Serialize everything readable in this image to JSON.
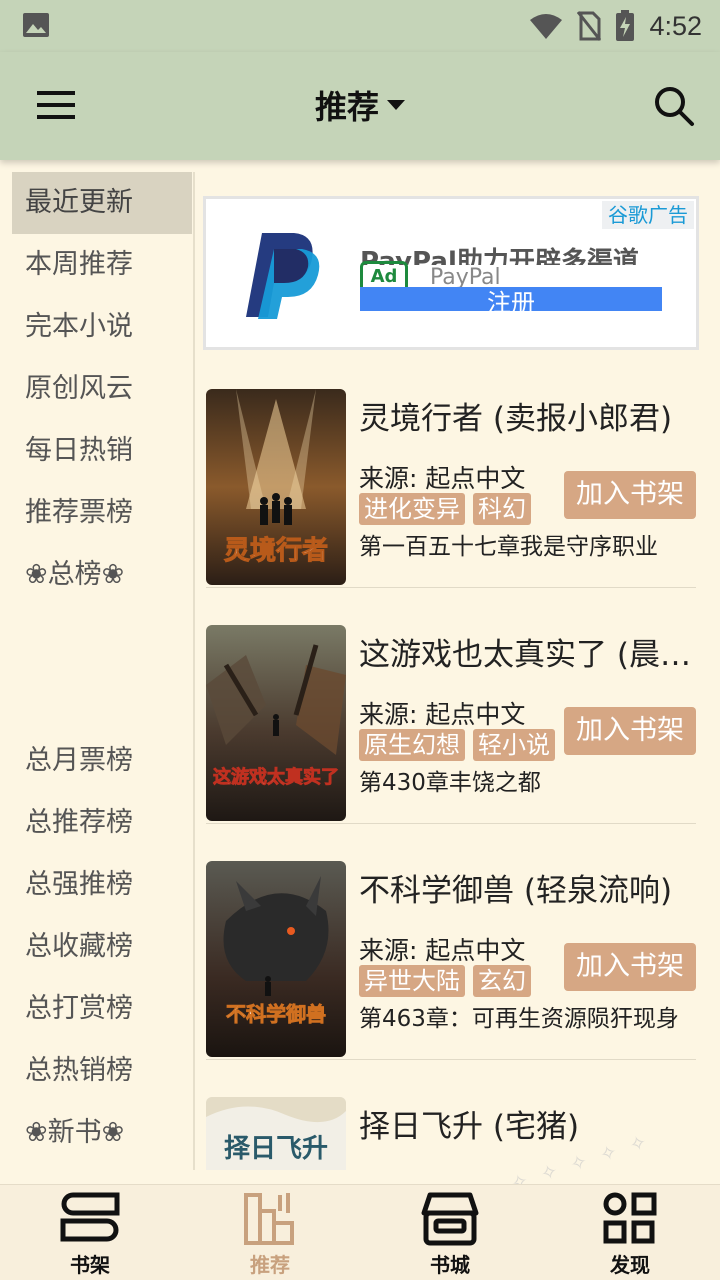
{
  "status_bar": {
    "time": "4:52"
  },
  "toolbar": {
    "title": "推荐"
  },
  "categories": [
    {
      "label": "最近更新",
      "active": true
    },
    {
      "label": "本周推荐"
    },
    {
      "label": "完本小说"
    },
    {
      "label": "原创风云"
    },
    {
      "label": "每日热销"
    },
    {
      "label": "推荐票榜"
    },
    {
      "label": "❀总榜❀"
    },
    {
      "label": ""
    },
    {
      "label": "总月票榜"
    },
    {
      "label": "总推荐榜"
    },
    {
      "label": "总强推榜"
    },
    {
      "label": "总收藏榜"
    },
    {
      "label": "总打赏榜"
    },
    {
      "label": "总热销榜"
    },
    {
      "label": "❀新书❀"
    }
  ],
  "ad": {
    "tag": "谷歌广告",
    "headline": "PayPal助力开辟多渠道",
    "badge": "Ad",
    "brand": "PayPal",
    "cta": "注册"
  },
  "books": [
    {
      "title": "灵境行者 (卖报小郎君)",
      "source": "来源: 起点中文",
      "tags": [
        "进化变异",
        "科幻"
      ],
      "latest": "第一百五十七章我是守序职业",
      "add_label": "加入书架",
      "cover_text": "灵境行者"
    },
    {
      "title": "这游戏也太真实了 (晨星LL)",
      "source": "来源: 起点中文",
      "tags": [
        "原生幻想",
        "轻小说"
      ],
      "latest": "第430章丰饶之都",
      "add_label": "加入书架",
      "cover_text": "这游戏太真实了"
    },
    {
      "title": "不科学御兽 (轻泉流响)",
      "source": "来源: 起点中文",
      "tags": [
        "异世大陆",
        "玄幻"
      ],
      "latest": "第463章：可再生资源陨犴现身",
      "add_label": "加入书架",
      "cover_text": "不科学御兽"
    },
    {
      "title": "择日飞升 (宅猪)",
      "source": "",
      "tags": [],
      "latest": "",
      "add_label": "",
      "cover_text": "择日飞升"
    }
  ],
  "bottom_nav": [
    {
      "label": "书架",
      "icon": "bookshelf-icon"
    },
    {
      "label": "推荐",
      "icon": "recommend-icon",
      "active": true
    },
    {
      "label": "书城",
      "icon": "bookstore-icon"
    },
    {
      "label": "发现",
      "icon": "discover-icon"
    }
  ],
  "colors": {
    "toolbar": "#c5d4b8",
    "background": "#fdf6e3",
    "accent": "#d6a784",
    "active_nav": "#c8a17e"
  }
}
